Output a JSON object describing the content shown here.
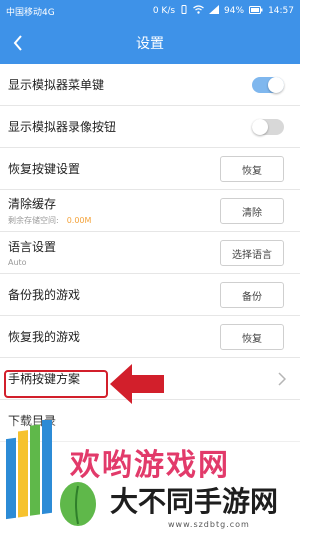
{
  "status_bar": {
    "carrier": "中国移动4G",
    "speed": "0 K/s",
    "battery": "94%",
    "time": "14:57"
  },
  "nav": {
    "title": "设置"
  },
  "rows": [
    {
      "title": "显示模拟器菜单键",
      "control": "toggle",
      "state": "on"
    },
    {
      "title": "显示模拟器录像按钮",
      "control": "toggle",
      "state": "off"
    },
    {
      "title": "恢复按键设置",
      "control": "button",
      "button_label": "恢复"
    },
    {
      "title": "清除缓存",
      "sub_label": "剩余存储空间:",
      "sub_value": "0.00M",
      "control": "button",
      "button_label": "清除"
    },
    {
      "title": "语言设置",
      "sub_label": "Auto",
      "control": "button",
      "button_label": "选择语言"
    },
    {
      "title": "备份我的游戏",
      "control": "button",
      "button_label": "备份"
    },
    {
      "title": "恢复我的游戏",
      "control": "button",
      "button_label": "恢复"
    },
    {
      "title": "手柄按键方案",
      "control": "chevron"
    },
    {
      "title": "下载目录",
      "control": "none"
    }
  ],
  "banner": {
    "top_text": "欢哟游戏网",
    "main_text": "大不同手游网",
    "url": "www.szdbtg.com"
  },
  "colors": {
    "primary": "#3e92e8",
    "toggle_on": "#7fb7ee",
    "highlight": "#d21f2b",
    "cache_value": "#f3a23a"
  }
}
